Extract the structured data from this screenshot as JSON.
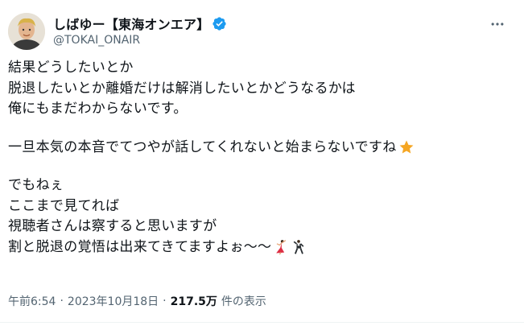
{
  "author": {
    "display_name": "しばゆー【東海オンエア】",
    "handle": "@TOKAI_ONAIR",
    "verified": true
  },
  "tweet": {
    "lines": [
      "結果どうしたいとか",
      "脱退したいとか離婚だけは解消したいとかどうなるかは",
      "俺にもまだわからないです。",
      "",
      "一旦本気の本音でてつやが話してくれないと始まらないですね",
      "",
      "でもねぇ",
      "ここまで見てれば",
      "視聴者さんは察すると思いますが",
      "割と脱退の覚悟は出来てきてますよぉ〜〜"
    ],
    "emoji_after_line_5": "star-emoji",
    "emoji_after_line_10": [
      "dancing-woman-emoji",
      "dancing-man-emoji"
    ]
  },
  "meta": {
    "time": "午前6:54",
    "separator": "·",
    "date": "2023年10月18日",
    "views_count": "217.5万",
    "views_label": "件の表示"
  },
  "colors": {
    "text": "#0f1419",
    "secondary": "#536471",
    "verified": "#1d9bf0",
    "star": "#f5a623"
  }
}
